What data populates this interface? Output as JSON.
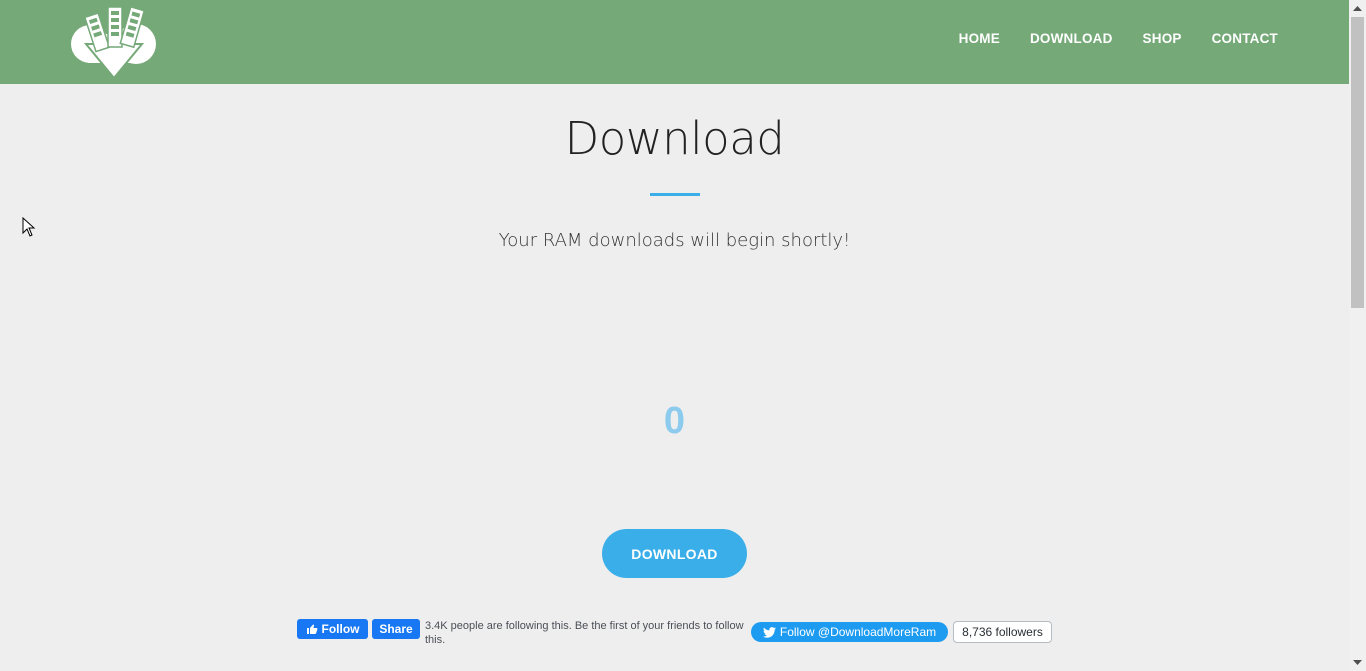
{
  "nav": {
    "items": [
      "HOME",
      "DOWNLOAD",
      "SHOP",
      "CONTACT"
    ]
  },
  "main": {
    "title": "Download",
    "subtitle": "Your RAM downloads will begin shortly!",
    "counter": "0",
    "download_button": "DOWNLOAD"
  },
  "social": {
    "fb_follow": "Follow",
    "fb_share": "Share",
    "fb_text": "3.4K people are following this. Be the first of your friends to follow this.",
    "twitter_follow": "Follow @DownloadMoreRam",
    "twitter_count": "8,736 followers"
  },
  "colors": {
    "header": "#75a978",
    "accent": "#3aaee8",
    "counter": "#8ccbee",
    "facebook": "#1877f2",
    "twitter": "#1d9bf0"
  },
  "icons": [
    "ram-cloud-download-logo",
    "thumbs-up-icon",
    "twitter-bird-icon",
    "mouse-cursor-icon"
  ]
}
